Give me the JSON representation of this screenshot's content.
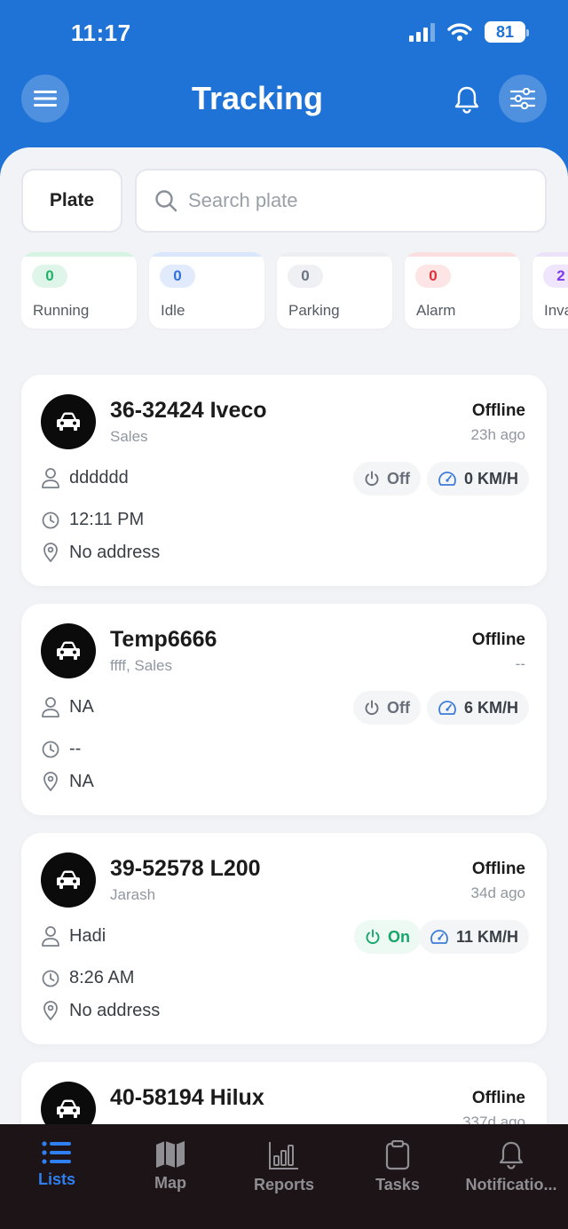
{
  "status_bar": {
    "time": "11:17",
    "battery": "81"
  },
  "header": {
    "title": "Tracking"
  },
  "filter": {
    "plate_label": "Plate",
    "search_placeholder": "Search plate"
  },
  "stats": [
    {
      "count": "0",
      "label": "Running",
      "color": "#22b36b"
    },
    {
      "count": "0",
      "label": "Idle",
      "color": "#2f6fe0"
    },
    {
      "count": "0",
      "label": "Parking",
      "color": "#6b7280"
    },
    {
      "count": "0",
      "label": "Alarm",
      "color": "#e0303a"
    },
    {
      "count": "2",
      "label": "Inva",
      "color": "#7c3aed"
    }
  ],
  "vehicles": [
    {
      "plate": "36-32424 Iveco",
      "group": "Sales",
      "status": "Offline",
      "ago": "23h ago",
      "driver": "dddddd",
      "power": "Off",
      "speed": "0 KM/H",
      "time": "12:11 PM",
      "address": "No address"
    },
    {
      "plate": "Temp6666",
      "group": "ffff, Sales",
      "status": "Offline",
      "ago": "--",
      "driver": "NA",
      "power": "Off",
      "speed": "6 KM/H",
      "time": "--",
      "address": "NA"
    },
    {
      "plate": "39-52578 L200",
      "group": "Jarash",
      "status": "Offline",
      "ago": "34d ago",
      "driver": "Hadi",
      "power": "On",
      "speed": "11 KM/H",
      "time": "8:26 AM",
      "address": "No address"
    },
    {
      "plate": "40-58194 Hilux",
      "group": "",
      "status": "Offline",
      "ago": "337d ago",
      "driver": "",
      "power": "",
      "speed": "",
      "time": "",
      "address": ""
    }
  ],
  "nav": [
    {
      "label": "Lists",
      "icon": "list-icon",
      "active": true
    },
    {
      "label": "Map",
      "icon": "map-icon",
      "active": false
    },
    {
      "label": "Reports",
      "icon": "reports-icon",
      "active": false
    },
    {
      "label": "Tasks",
      "icon": "clipboard-icon",
      "active": false
    },
    {
      "label": "Notificatio...",
      "icon": "bell-icon",
      "active": false
    }
  ]
}
